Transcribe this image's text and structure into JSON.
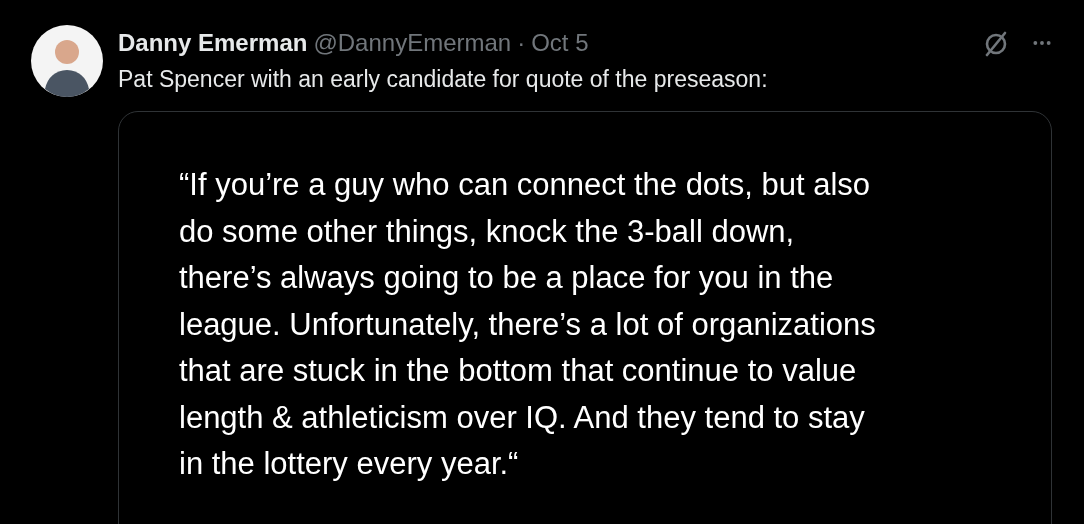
{
  "post": {
    "author": {
      "name": "Danny Emerman",
      "handle": "@DannyEmerman",
      "separator": "·",
      "date": "Oct 5"
    },
    "text": "Pat Spencer with an early candidate for quote of the preseason:",
    "media": {
      "kind": "quote",
      "lines": [
        "“If you’re a guy who can connect the dots, but also",
        "do some other things, knock the 3-ball down,",
        "there’s always going to be a place for you in the",
        "league. Unfortunately, there’s a lot of organizations",
        "that are stuck in the bottom that continue to value",
        "length & athleticism over IQ. And they tend to stay",
        "in the lottery every year.“"
      ]
    }
  }
}
